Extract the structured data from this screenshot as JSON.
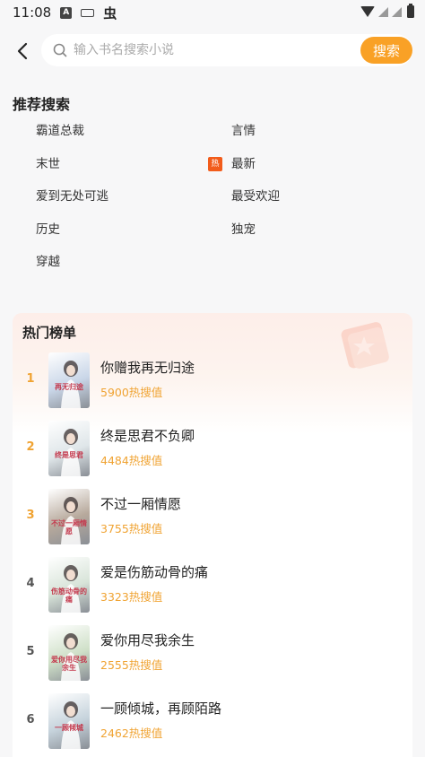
{
  "status_bar": {
    "time": "11:08",
    "icons": [
      "a-box-icon",
      "keyboard-icon",
      "bug-icon"
    ],
    "glyph": "虫"
  },
  "header": {
    "search_placeholder": "输入书名搜索小说",
    "search_button": "搜索"
  },
  "recommended": {
    "title": "推荐搜索",
    "items": [
      {
        "label": "霸道总裁",
        "hot": false
      },
      {
        "label": "言情",
        "hot": false
      },
      {
        "label": "末世",
        "hot": false
      },
      {
        "label": "最新",
        "hot": true,
        "badge": "热"
      },
      {
        "label": "爱到无处可逃",
        "hot": false
      },
      {
        "label": "最受欢迎",
        "hot": false
      },
      {
        "label": "历史",
        "hot": false
      },
      {
        "label": "独宠",
        "hot": false
      },
      {
        "label": "穿越",
        "hot": false
      }
    ]
  },
  "hot_list": {
    "title": "热门榜单",
    "books": [
      {
        "rank": "1",
        "title": "你赠我再无归途",
        "heat": "5900热搜值",
        "cover_text": "再无归途",
        "rank_color": "#f0a332",
        "cover_color": "#c9d6e8"
      },
      {
        "rank": "2",
        "title": "终是思君不负卿",
        "heat": "4484热搜值",
        "cover_text": "终是思君",
        "rank_color": "#f0a332",
        "cover_color": "#dfe6e9"
      },
      {
        "rank": "3",
        "title": "不过一厢情愿",
        "heat": "3755热搜值",
        "cover_text": "不过一厢情愿",
        "rank_color": "#f0a332",
        "cover_color": "#b7a99c"
      },
      {
        "rank": "4",
        "title": "爱是伤筋动骨的痛",
        "heat": "3323热搜值",
        "cover_text": "伤筋动骨的痛",
        "rank_color": "#555555",
        "cover_color": "#d8e4d9"
      },
      {
        "rank": "5",
        "title": "爱你用尽我余生",
        "heat": "2555热搜值",
        "cover_text": "爱你用尽我余生",
        "rank_color": "#555555",
        "cover_color": "#cfe0c8"
      },
      {
        "rank": "6",
        "title": "一顾倾城，再顾陌路",
        "heat": "2462热搜值",
        "cover_text": "一顾倾城",
        "rank_color": "#555555",
        "cover_color": "#c6d3dc"
      }
    ]
  },
  "colors": {
    "accent": "#f9a126",
    "hot_badge": "#f25c1b",
    "heat_text": "#f0a332"
  }
}
